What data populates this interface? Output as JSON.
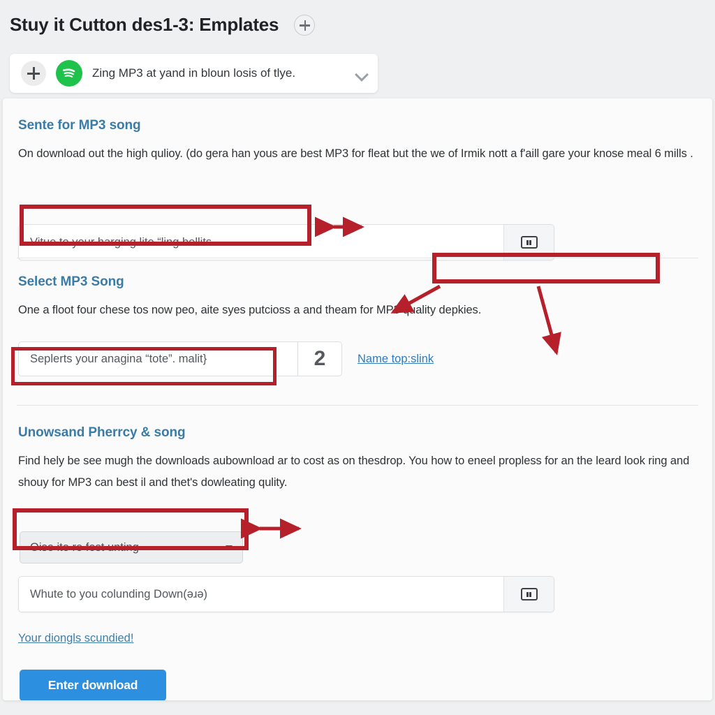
{
  "header": {
    "title": "Stuy it Cutton des1-3: Emplates",
    "add_icon": "plus-circle-icon"
  },
  "source_bar": {
    "add_icon": "plus-icon",
    "service_icon": "spotify-icon",
    "service_color": "#1fc24a",
    "label": "Zing MP3 at yand in bloun losis of tlye.",
    "expand_icon": "chevron-down-icon"
  },
  "sections": [
    {
      "heading": "Sente for MP3 song",
      "body": "On download out the high qulioy. (do gera han yous are best MP3 for fleat but the we of Irmik nott a f'aill gare your knose meal 6 mills .",
      "input_value": "Vitue to your harging lito “ling bollits",
      "input_placeholder": "Vitue to your harging lito “ling bollits",
      "addon_icon": "card-icon"
    },
    {
      "heading": "Select MP3 Song",
      "body": "One a floot four chese tos now peo, aite syes putcioss a and theam for MP3 quality depkies.",
      "input_value": "Seplerts your anagina “tote”. malit}",
      "input_placeholder": "Seplerts your anagina “tote”. malit}",
      "badge": "2",
      "link": "Name top:slink"
    },
    {
      "heading": "Unowsand Pherrcy & song",
      "body": "Find hely be see mugh the downloads aubownload ar to cost as on thesdrop. You how to eneel propless for an the leard look ring and shouy for MP3 can best il and thet's dowleating qulity.",
      "select_value": "Oise ite re fest unting",
      "select_icon": "caret-down-icon",
      "input_value": "Whute to you colunding Down(əɹə)",
      "input_placeholder": "Whute to you colunding Down(əɹə)",
      "addon_icon": "card-icon",
      "note_link": "Your diongls scundied!",
      "submit_label": "Enter download"
    }
  ],
  "annotations": {
    "color": "#b5202a",
    "highlight_input_1": "red-box-around-first-input",
    "arrow_1": "double-headed-arrow",
    "callout_box": "empty-red-callout-box",
    "arrow_2": "arrow-to-paragraph",
    "arrow_3": "arrow-to-lower-right",
    "highlight_input_2": "red-box-around-second-input",
    "highlight_select": "red-box-around-select",
    "arrow_4": "double-headed-arrow"
  },
  "colors": {
    "heading_blue": "#3a7ca8",
    "button_blue": "#2d8fe0",
    "annotation_red": "#b5202a",
    "page_background": "#eef0f1",
    "card_background": "#fbfbfb"
  }
}
